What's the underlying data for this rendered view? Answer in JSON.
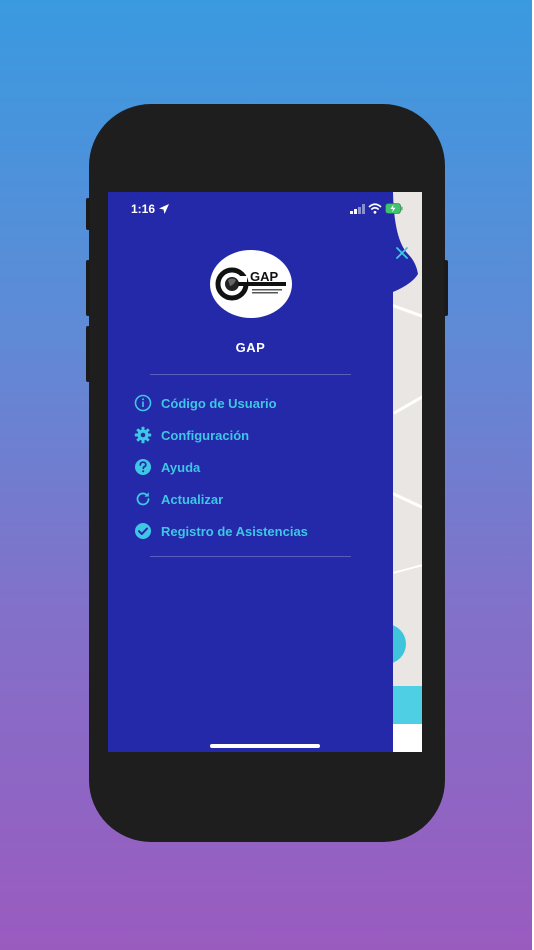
{
  "status_bar": {
    "time": "1:16"
  },
  "drawer": {
    "app_name": "GAP",
    "logo_text": "GAP",
    "menu": [
      {
        "label": "Código de Usuario",
        "icon": "info-icon"
      },
      {
        "label": "Configuración",
        "icon": "gear-icon"
      },
      {
        "label": "Ayuda",
        "icon": "help-icon"
      },
      {
        "label": "Actualizar",
        "icon": "refresh-icon"
      },
      {
        "label": "Registro de Asistencias",
        "icon": "check-circle-icon"
      }
    ]
  },
  "colors": {
    "drawer_bg": "#2329a8",
    "accent": "#3fc6e4",
    "map_bg": "#e9e6e3",
    "map_accent": "#4ecfe3"
  }
}
